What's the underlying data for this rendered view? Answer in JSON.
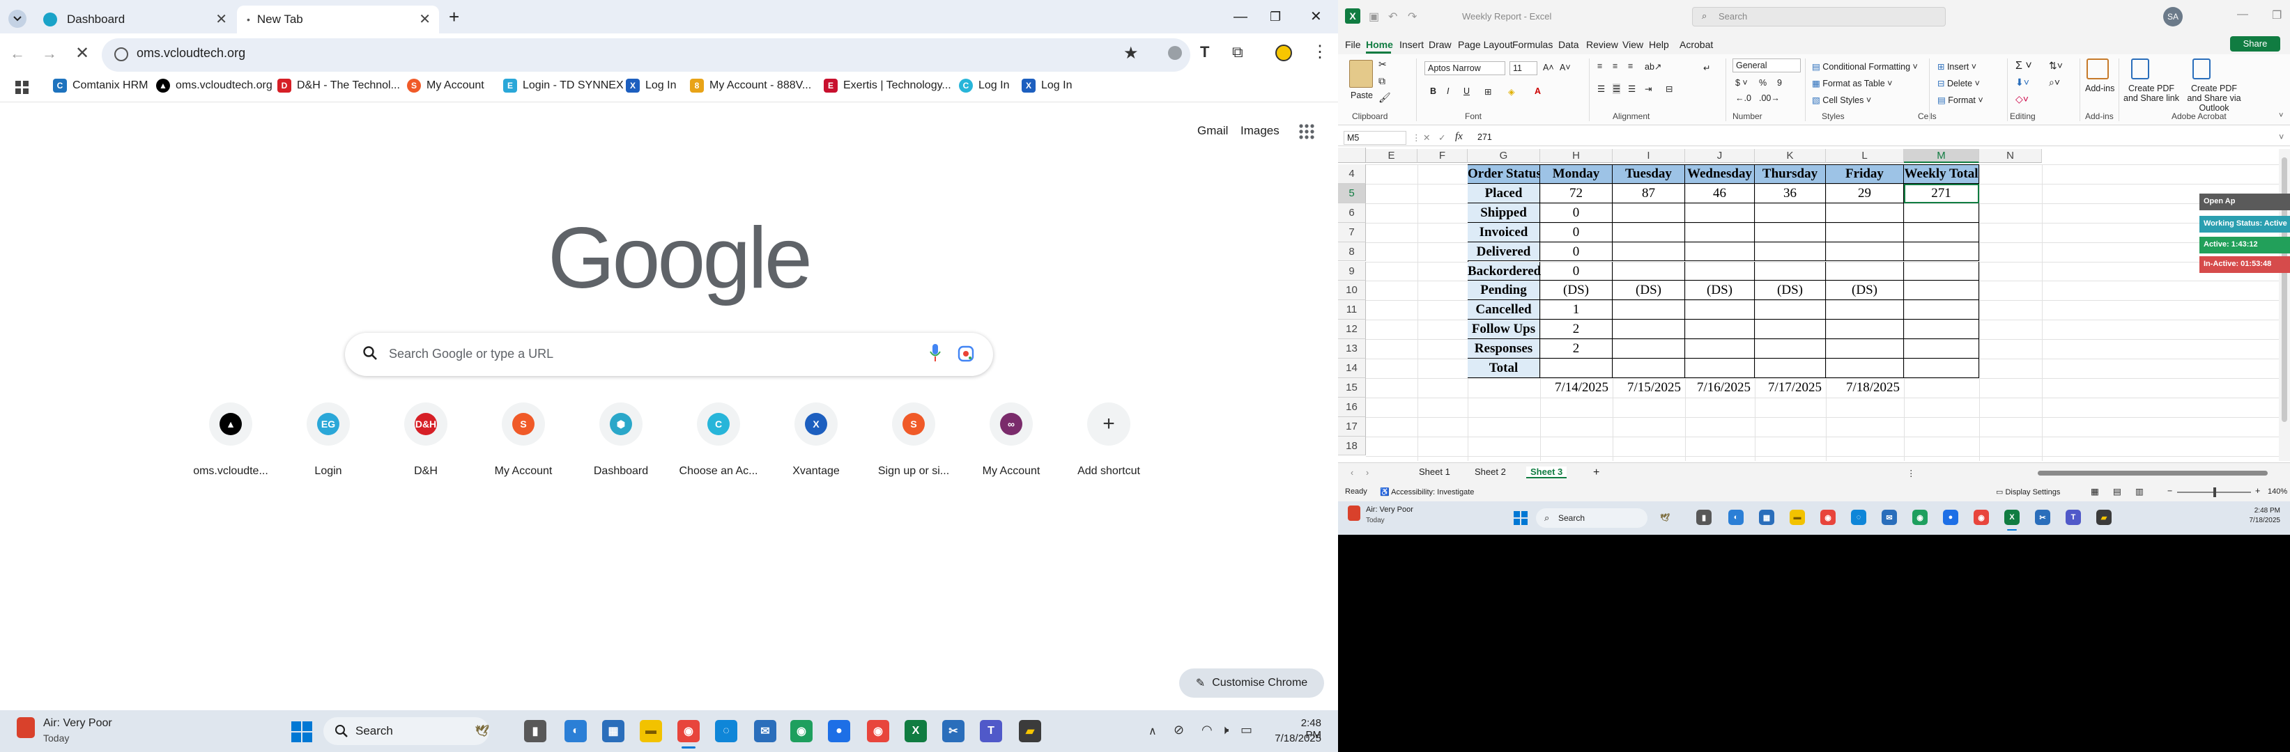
{
  "chrome": {
    "tabs": [
      {
        "title": "Dashboard"
      },
      {
        "title": "New Tab"
      }
    ],
    "url": "oms.vcloudtech.org",
    "bookmarks": [
      {
        "label": "Comtanix HRM"
      },
      {
        "label": "oms.vcloudtech.org"
      },
      {
        "label": "D&H - The Technol..."
      },
      {
        "label": "My Account"
      },
      {
        "label": "Login - TD SYNNEX"
      },
      {
        "label": "Log In"
      },
      {
        "label": "My Account - 888V..."
      },
      {
        "label": "Exertis | Technology..."
      },
      {
        "label": "Log In"
      },
      {
        "label": "Log In"
      }
    ],
    "top_links": {
      "gmail": "Gmail",
      "images": "Images"
    },
    "logo_text": "Google",
    "search_placeholder": "Search Google or type a URL",
    "shortcuts": [
      {
        "label": "oms.vcloudte...",
        "icon": "vcloud-icon",
        "color": "#000000"
      },
      {
        "label": "Login",
        "icon": "eg-icon",
        "color": "#2aa7d8"
      },
      {
        "label": "D&H",
        "icon": "dh-icon",
        "color": "#d61f26"
      },
      {
        "label": "My Account",
        "icon": "s-logo-icon",
        "color": "#f05a28"
      },
      {
        "label": "Dashboard",
        "icon": "hexagon-icon",
        "color": "#2aa7c9"
      },
      {
        "label": "Choose an Ac...",
        "icon": "c-logo-icon",
        "color": "#27b5d9"
      },
      {
        "label": "Xvantage",
        "icon": "xvantage-icon",
        "color": "#1d5fbf"
      },
      {
        "label": "Sign up or si...",
        "icon": "s-logo-icon",
        "color": "#f05a28"
      },
      {
        "label": "My Account",
        "icon": "rings-icon",
        "color": "#7a2b6b"
      },
      {
        "label": "Add shortcut",
        "icon": "plus-icon",
        "color": "#5f6368"
      }
    ],
    "customise_label": "Customise Chrome"
  },
  "taskbar": {
    "weather_title": "Air: Very Poor",
    "weather_sub": "Today",
    "search_label": "Search",
    "time": "2:48 PM",
    "date": "7/18/2025"
  },
  "excel": {
    "title": "Weekly Report - Excel",
    "search_placeholder": "Search",
    "avatar": "SA",
    "share_label": "Share",
    "menu": [
      "File",
      "Home",
      "Insert",
      "Draw",
      "Page Layout",
      "Formulas",
      "Data",
      "Review",
      "View",
      "Help",
      "Acrobat"
    ],
    "ribbon": {
      "paste": "Paste",
      "font_name": "Aptos Narrow",
      "font_size": "11",
      "number_format": "General",
      "conditional_formatting": "Conditional Formatting",
      "format_as_table": "Format as Table",
      "cell_styles": "Cell Styles",
      "insert": "Insert",
      "delete": "Delete",
      "format": "Format",
      "addins": "Add-ins",
      "create_pdf_share": "Create PDF and Share link",
      "create_pdf_outlook": "Create PDF and Share via Outlook",
      "groups": [
        "Clipboard",
        "Font",
        "Alignment",
        "Number",
        "Styles",
        "Cells",
        "Editing",
        "Add-ins",
        "Adobe Acrobat"
      ]
    },
    "name_box": "M5",
    "formula": "271",
    "columns": [
      "E",
      "F",
      "G",
      "H",
      "I",
      "J",
      "K",
      "L",
      "M",
      "N"
    ],
    "rows": [
      "4",
      "5",
      "6",
      "7",
      "8",
      "9",
      "10",
      "11",
      "12",
      "13",
      "14",
      "15",
      "16",
      "17",
      "18"
    ],
    "table": {
      "headers": [
        "Order Status",
        "Monday",
        "Tuesday",
        "Wednesday",
        "Thursday",
        "Friday",
        "Weekly Total"
      ],
      "rows": [
        [
          "Placed",
          "72",
          "87",
          "46",
          "36",
          "29",
          "271"
        ],
        [
          "Shipped",
          "0",
          "",
          "",
          "",
          "",
          ""
        ],
        [
          "Invoiced",
          "0",
          "",
          "",
          "",
          "",
          ""
        ],
        [
          "Delivered",
          "0",
          "",
          "",
          "",
          "",
          ""
        ],
        [
          "Backordered",
          "0",
          "",
          "",
          "",
          "",
          ""
        ],
        [
          "Pending",
          "(DS)",
          "(DS)",
          "(DS)",
          "(DS)",
          "(DS)",
          ""
        ],
        [
          "Cancelled",
          "1",
          "",
          "",
          "",
          "",
          ""
        ],
        [
          "Follow Ups",
          "2",
          "",
          "",
          "",
          "",
          ""
        ],
        [
          "Responses",
          "2",
          "",
          "",
          "",
          "",
          ""
        ],
        [
          "Total",
          "",
          "",
          "",
          "",
          "",
          ""
        ]
      ],
      "dates": [
        "7/14/2025",
        "7/15/2025",
        "7/16/2025",
        "7/17/2025",
        "7/18/2025"
      ]
    },
    "overlay": {
      "open": "Open Ap",
      "working": "Working Status: Active",
      "active": "Active: 1:43:12",
      "inactive": "In-Active: 01:53:48"
    },
    "sheets": [
      "Sheet 1",
      "Sheet 2",
      "Sheet 3"
    ],
    "active_sheet": "Sheet 3",
    "status": {
      "ready": "Ready",
      "accessibility": "Accessibility: Investigate",
      "display_settings": "Display Settings",
      "zoom": "140%"
    }
  }
}
